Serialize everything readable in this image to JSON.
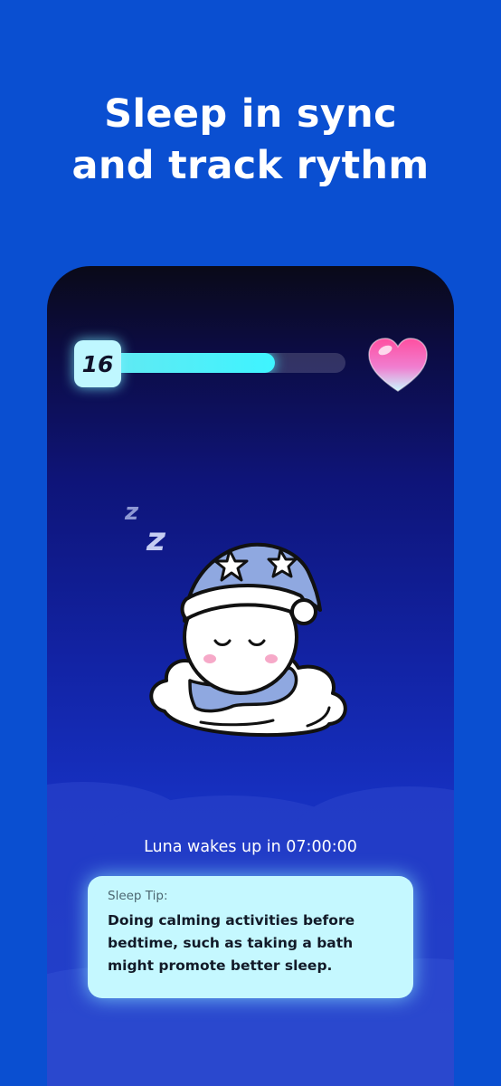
{
  "headline": {
    "line1": "Sleep in sync",
    "line2": "and track rythm"
  },
  "status": {
    "level": "16",
    "progress_fraction": 0.7
  },
  "icons": {
    "zzz": "zzz-icon",
    "heart": "heart-icon",
    "mascot": "sleeping-mascot"
  },
  "wake": {
    "text": "Luna wakes up in 07:00:00"
  },
  "tip": {
    "title": "Sleep Tip:",
    "body": "Doing calming activities before bedtime, such as taking a bath might promote better sleep."
  },
  "colors": {
    "background": "#0a4fd1",
    "accent": "#3ef4ff",
    "card": "#c5f8ff"
  }
}
